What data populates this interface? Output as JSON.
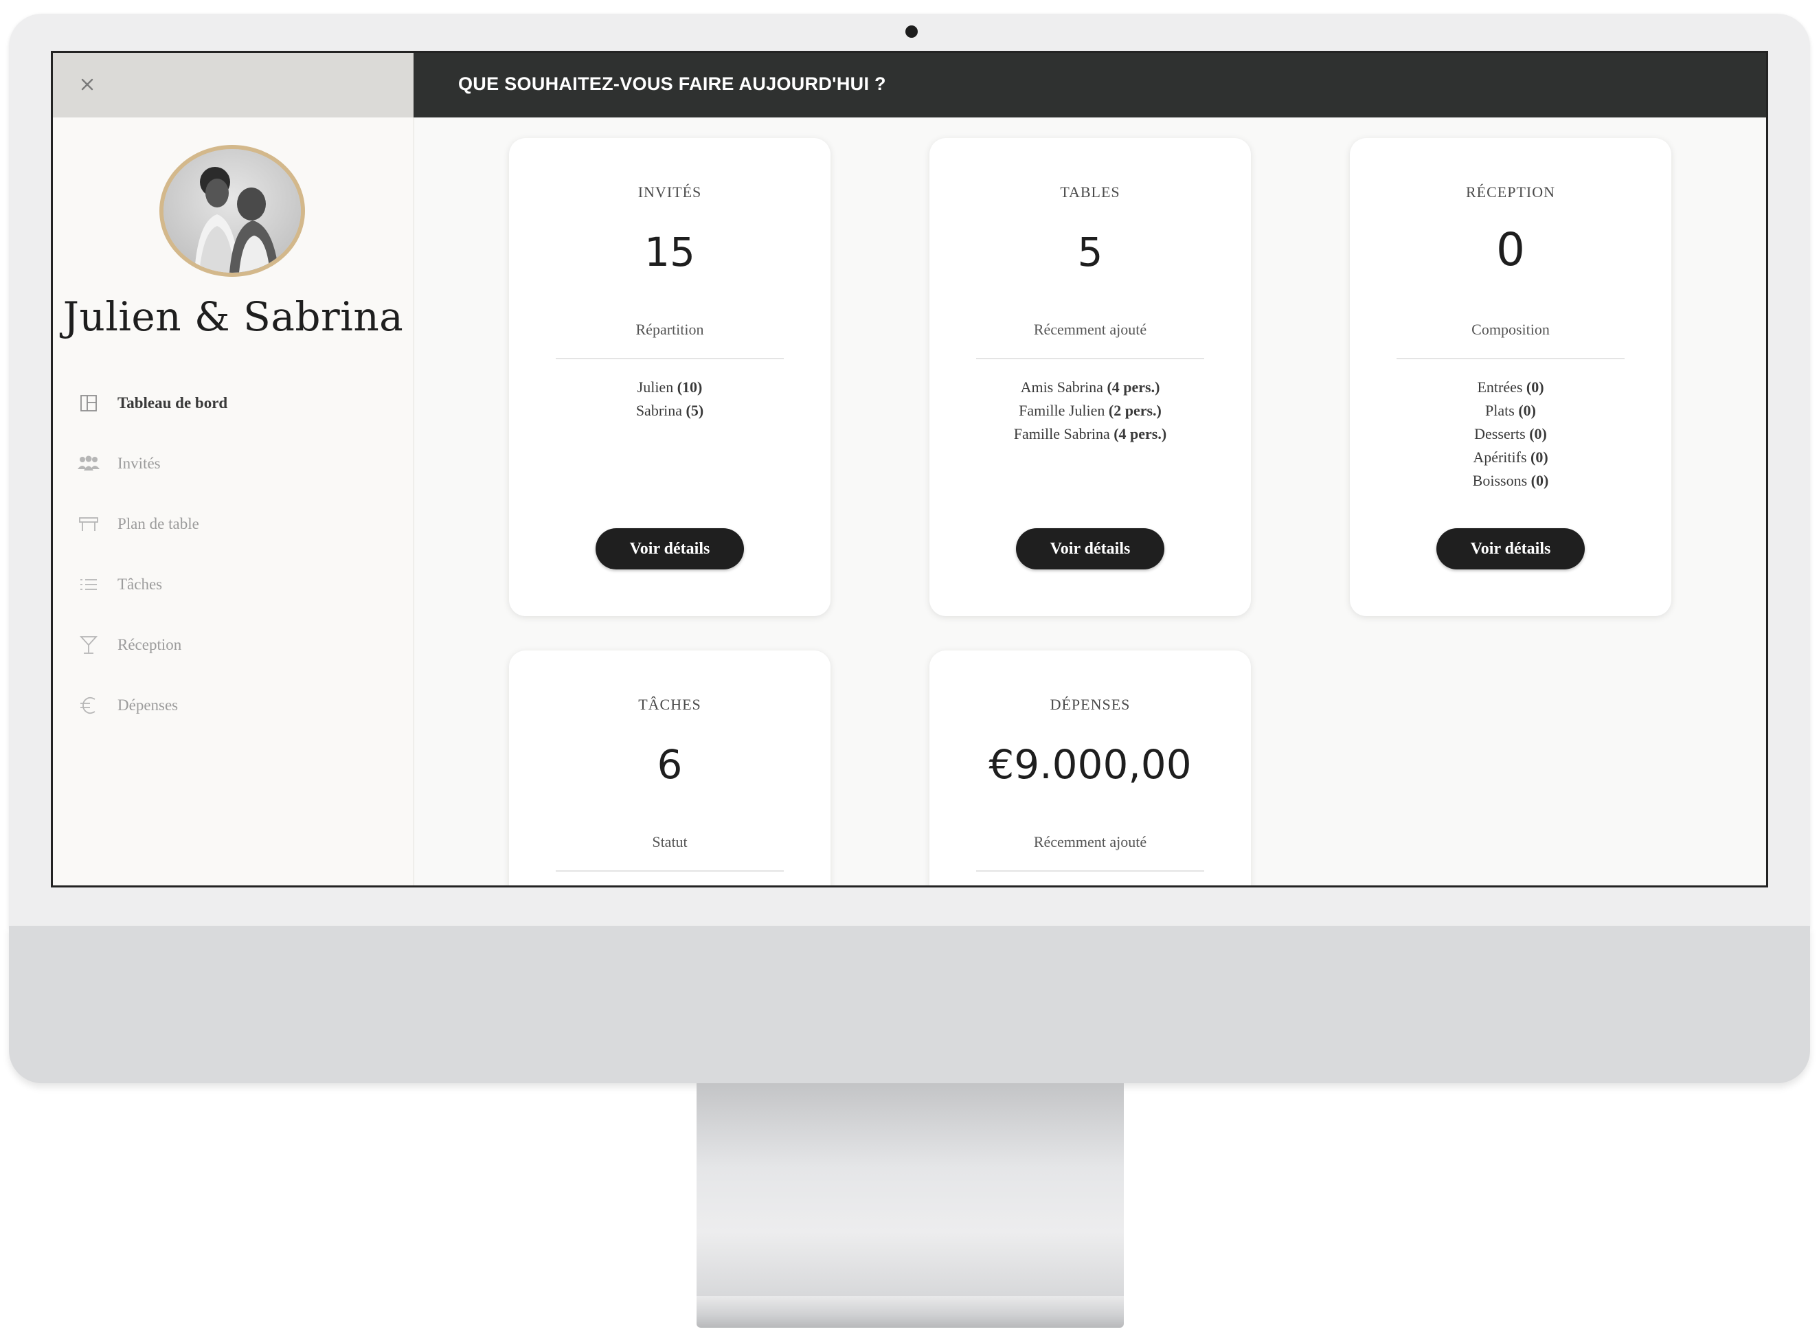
{
  "topbar": {
    "title": "QUE SOUHAITEZ-VOUS FAIRE AUJOURD'HUI ?"
  },
  "sidebar": {
    "couple_name": "Julien & Sabrina",
    "items": [
      {
        "label": "Tableau de bord",
        "icon": "dashboard-icon",
        "active": true
      },
      {
        "label": "Invités",
        "icon": "guests-icon"
      },
      {
        "label": "Plan de table",
        "icon": "table-icon"
      },
      {
        "label": "Tâches",
        "icon": "list-icon"
      },
      {
        "label": "Réception",
        "icon": "cocktail-glass-icon"
      },
      {
        "label": "Dépenses",
        "icon": "euro-icon"
      }
    ]
  },
  "cards": {
    "invites": {
      "title": "INVITÉS",
      "value": "15",
      "subtitle": "Répartition",
      "items": [
        {
          "name": "Julien",
          "detail": "(10)"
        },
        {
          "name": "Sabrina",
          "detail": "(5)"
        }
      ],
      "button": "Voir détails"
    },
    "tables": {
      "title": "TABLES",
      "value": "5",
      "subtitle": "Récemment ajouté",
      "items": [
        {
          "name": "Amis Sabrina",
          "detail": "(4 pers.)"
        },
        {
          "name": "Famille Julien",
          "detail": "(2 pers.)"
        },
        {
          "name": "Famille Sabrina",
          "detail": "(4 pers.)"
        }
      ],
      "button": "Voir détails"
    },
    "reception": {
      "title": "RÉCEPTION",
      "value": "0",
      "subtitle": "Composition",
      "items": [
        {
          "name": "Entrées",
          "detail": "(0)"
        },
        {
          "name": "Plats",
          "detail": "(0)"
        },
        {
          "name": "Desserts",
          "detail": "(0)"
        },
        {
          "name": "Apéritifs",
          "detail": "(0)"
        },
        {
          "name": "Boissons",
          "detail": "(0)"
        }
      ],
      "button": "Voir détails"
    },
    "taches": {
      "title": "TÂCHES",
      "value": "6",
      "subtitle": "Statut"
    },
    "depenses": {
      "title": "DÉPENSES",
      "value": "€9.000,00",
      "subtitle": "Récemment ajouté"
    }
  },
  "colors": {
    "topbar": "#2f3130",
    "accent_ring": "#d3b88b",
    "button": "#1f1f1f"
  }
}
